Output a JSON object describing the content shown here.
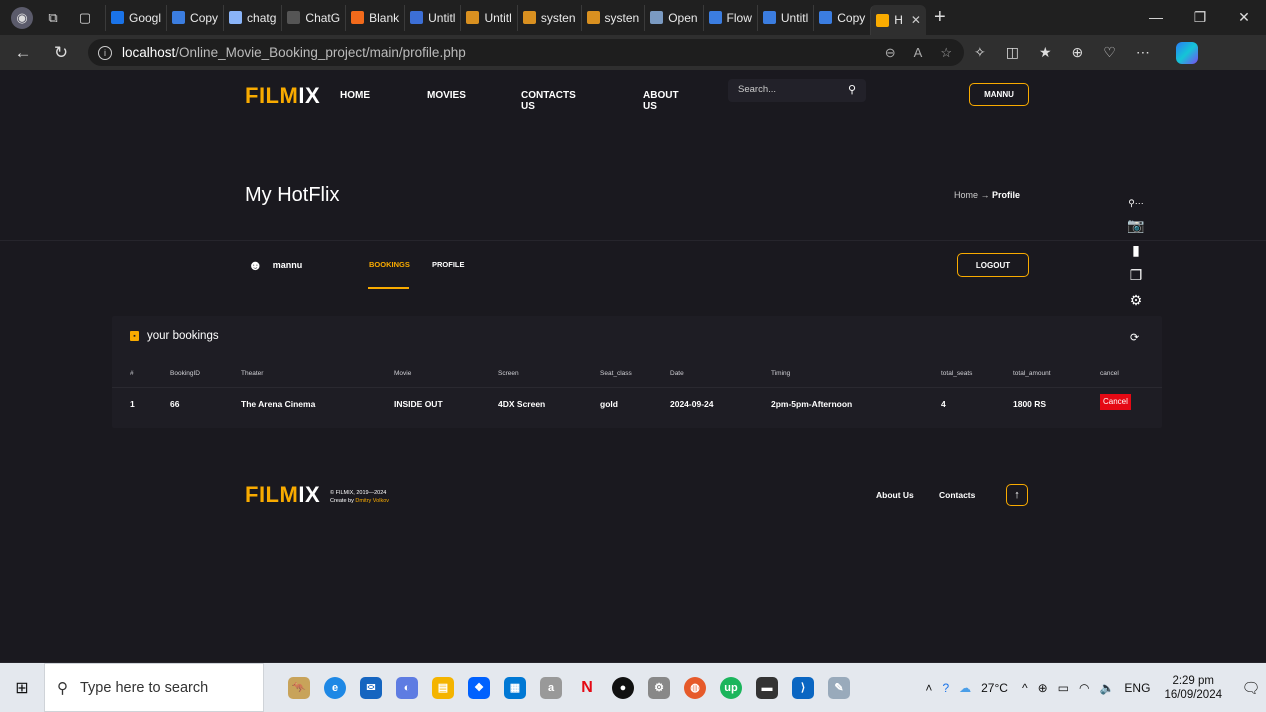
{
  "browser": {
    "tabs": [
      {
        "label": "Googl",
        "color": "#1a73e8"
      },
      {
        "label": "Copy",
        "color": "#3b7de0"
      },
      {
        "label": "chatg",
        "color": "#8ab4f8"
      },
      {
        "label": "ChatG",
        "color": "#555555"
      },
      {
        "label": "Blank",
        "color": "#f26a1b"
      },
      {
        "label": "Untitl",
        "color": "#3c6fd6"
      },
      {
        "label": "Untitl",
        "color": "#d99020"
      },
      {
        "label": "systen",
        "color": "#d99020"
      },
      {
        "label": "systen",
        "color": "#d99020"
      },
      {
        "label": "Open",
        "color": "#7a9ac2"
      },
      {
        "label": "Flow",
        "color": "#3b7de0"
      },
      {
        "label": "Untitl",
        "color": "#3b7de0"
      },
      {
        "label": "Copy",
        "color": "#3b7de0"
      },
      {
        "label": "H",
        "color": "#f9ab00",
        "active": true
      }
    ],
    "url_host": "localhost",
    "url_path": "/Online_Movie_Booking_project/main/profile.php"
  },
  "header": {
    "logo_part1": "FILM",
    "logo_part2": "IX",
    "nav": [
      "HOME",
      "MOVIES",
      "CONTACTS US",
      "ABOUT US"
    ],
    "search_placeholder": "Search...",
    "user_button": "MANNU"
  },
  "title_section": {
    "title": "My HotFlix",
    "crumb_home": "Home",
    "crumb_arrow": "→",
    "crumb_current": "Profile"
  },
  "profile_bar": {
    "username": "mannu",
    "tabs": [
      "BOOKINGS",
      "PROFILE"
    ],
    "logout": "LOGOUT"
  },
  "bookings": {
    "title": "your bookings",
    "columns": [
      "#",
      "BookingID",
      "Theater",
      "Movie",
      "Screen",
      "Seat_class",
      "Date",
      "Timing",
      "total_seats",
      "total_amount",
      "cancel"
    ],
    "rows": [
      [
        "1",
        "66",
        "The Arena Cinema",
        "INSIDE OUT",
        "4DX Screen",
        "gold",
        "2024-09-24",
        "2pm-5pm-Afternoon",
        "4",
        "1800 RS"
      ]
    ],
    "cancel_label": "Cancel"
  },
  "footer": {
    "logo_part1": "FILM",
    "logo_part2": "IX",
    "copyright": "© FILMIX, 2019—2024",
    "created_by": "Create by",
    "author": "Dmitry Volkov",
    "links": [
      "About Us",
      "Contacts"
    ],
    "up_button": "↑"
  },
  "taskbar": {
    "search_placeholder": "Type here to search",
    "weather": "27°C",
    "lang": "ENG",
    "time": "2:29 pm",
    "date": "16/09/2024"
  },
  "colors": {
    "accent": "#f9ab00",
    "background": "#1a191f",
    "cancel": "#e50914"
  }
}
